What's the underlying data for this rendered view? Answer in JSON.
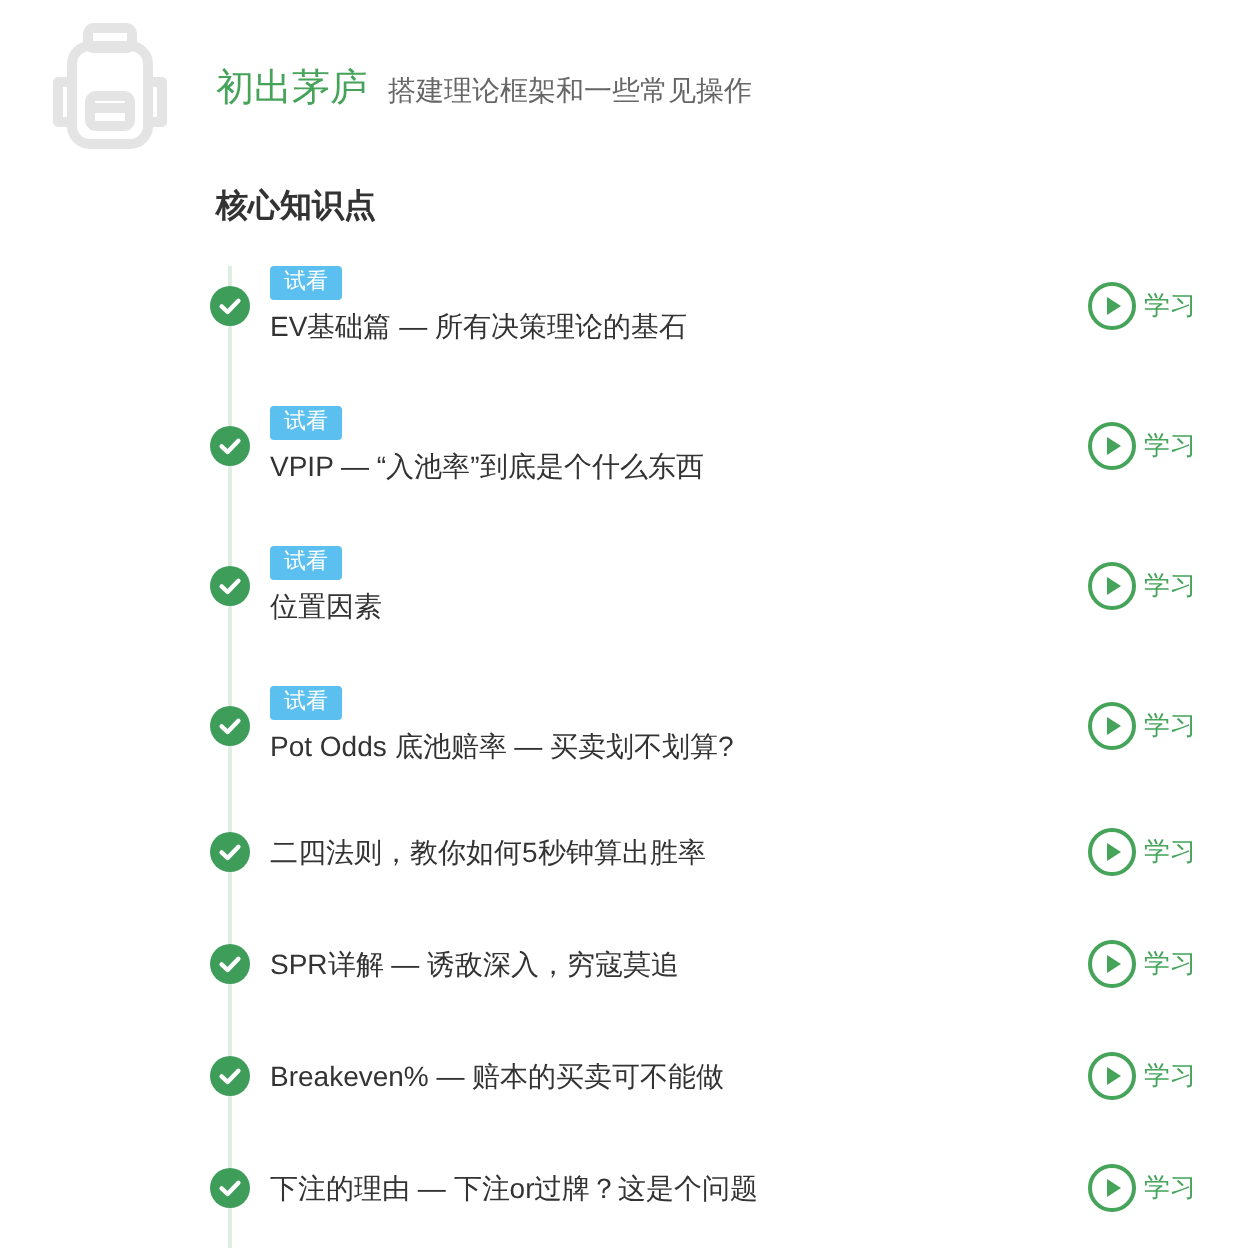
{
  "header": {
    "title": "初出茅庐",
    "subtitle": "搭建理论框架和一些常见操作"
  },
  "section": {
    "title": "核心知识点"
  },
  "lessons": [
    {
      "badge": "试看",
      "title": "EV基础篇 — 所有决策理论的基石",
      "completed": true,
      "action": "学习"
    },
    {
      "badge": "试看",
      "title": "VPIP — “入池率”到底是个什么东西",
      "completed": true,
      "action": "学习"
    },
    {
      "badge": "试看",
      "title": "位置因素",
      "completed": true,
      "action": "学习"
    },
    {
      "badge": "试看",
      "title": "Pot Odds 底池赔率 — 买卖划不划算?",
      "completed": true,
      "action": "学习"
    },
    {
      "title": "二四法则，教你如何5秒钟算出胜率",
      "completed": true,
      "action": "学习"
    },
    {
      "title": "SPR详解 — 诱敌深入，穷寇莫追",
      "completed": true,
      "action": "学习"
    },
    {
      "title": "Breakeven% — 赔本的买卖可不能做",
      "completed": true,
      "action": "学习"
    },
    {
      "title": "下注的理由 — 下注or过牌？这是个问题",
      "completed": true,
      "action": "学习"
    }
  ]
}
